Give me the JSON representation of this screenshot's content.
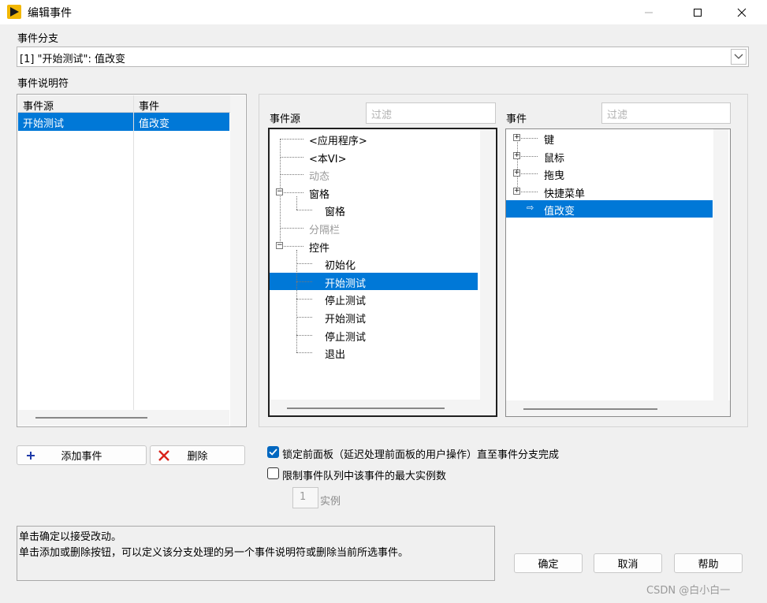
{
  "window": {
    "title": "编辑事件",
    "icon": "labview-run-arrow-icon",
    "accent": "#0078d7"
  },
  "labels": {
    "event_branch": "事件分支",
    "event_specifiers": "事件说明符",
    "event_source": "事件源",
    "events": "事件"
  },
  "branch": {
    "selected": "[1] \"开始测试\": 值改变"
  },
  "spec_table": {
    "headers": [
      "事件源",
      "事件"
    ],
    "rows": [
      {
        "source": "开始测试",
        "event": "值改变"
      }
    ]
  },
  "filters": {
    "source_placeholder": "过滤",
    "event_placeholder": "过滤"
  },
  "source_tree": [
    {
      "label": "<应用程序>",
      "level": 0
    },
    {
      "label": "<本VI>",
      "level": 0
    },
    {
      "label": "动态",
      "level": 0,
      "disabled": true
    },
    {
      "label": "窗格",
      "level": 0,
      "expanded": true
    },
    {
      "label": "窗格",
      "level": 1
    },
    {
      "label": "分隔栏",
      "level": 0,
      "disabled": true
    },
    {
      "label": "控件",
      "level": 0,
      "expanded": true
    },
    {
      "label": "初始化",
      "level": 1
    },
    {
      "label": "开始测试",
      "level": 1,
      "selected": true
    },
    {
      "label": "停止测试",
      "level": 1
    },
    {
      "label": "开始测试",
      "level": 1
    },
    {
      "label": "停止测试",
      "level": 1
    },
    {
      "label": "退出",
      "level": 1
    }
  ],
  "event_tree": [
    {
      "label": "键",
      "collapsed": true
    },
    {
      "label": "鼠标",
      "collapsed": true
    },
    {
      "label": "拖曳",
      "collapsed": true
    },
    {
      "label": "快捷菜单",
      "collapsed": true
    },
    {
      "label": "值改变",
      "selected": true,
      "leaf_arrow": "⇨"
    }
  ],
  "buttons": {
    "add": "添加事件",
    "delete": "删除",
    "ok": "确定",
    "cancel": "取消",
    "help": "帮助"
  },
  "options": {
    "lock_panel": {
      "label": "锁定前面板（延迟处理前面板的用户操作）直至事件分支完成",
      "checked": true
    },
    "limit_instances": {
      "label": "限制事件队列中该事件的最大实例数",
      "checked": false
    },
    "instances": {
      "value": "1",
      "unit": "实例"
    }
  },
  "message": {
    "line1": "单击确定以接受改动。",
    "line2": "单击添加或删除按钮，可以定义该分支处理的另一个事件说明符或删除当前所选事件。"
  },
  "watermark": "CSDN @白小白一"
}
